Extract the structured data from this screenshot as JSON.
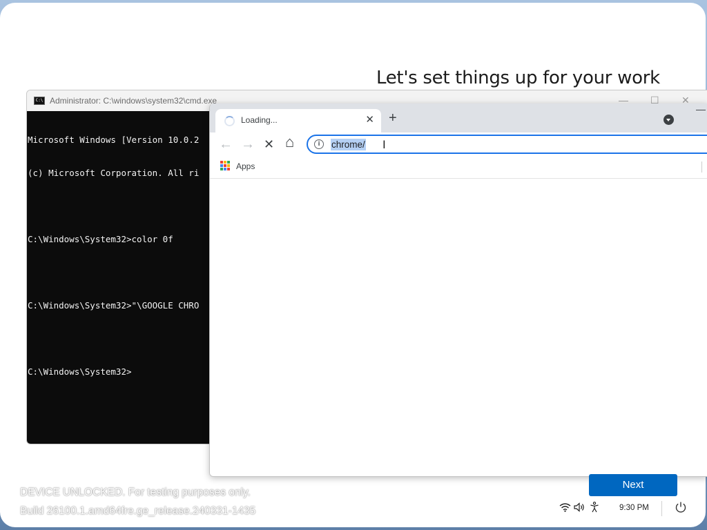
{
  "oobe": {
    "title": "Let's set things up for your work",
    "next_label": "Next",
    "watermark_line1": "DEVICE UNLOCKED. For testing purposes only.",
    "watermark_line2": "Build 26100.1.amd64fre.ge_release.240331-1435"
  },
  "cmd": {
    "title": "Administrator: C:\\windows\\system32\\cmd.exe",
    "lines": [
      "Microsoft Windows [Version 10.0.2",
      "(c) Microsoft Corporation. All ri",
      "",
      "C:\\Windows\\System32>color 0f",
      "",
      "C:\\Windows\\System32>\"\\GOOGLE CHRO",
      "",
      "C:\\Windows\\System32>"
    ],
    "controls": {
      "minimize": "—",
      "maximize": "☐",
      "close": "✕"
    }
  },
  "chrome": {
    "tab_title": "Loading...",
    "tab_close": "✕",
    "new_tab": "+",
    "omnibox_value": "chrome/",
    "bookmarks": {
      "apps_label": "Apps"
    },
    "nav": {
      "back": "←",
      "forward": "→",
      "stop": "✕",
      "home": "⌂"
    },
    "icons": [
      "loading-spinner-icon",
      "back-arrow-icon",
      "forward-arrow-icon",
      "stop-icon",
      "home-icon",
      "info-icon",
      "apps-grid-icon",
      "tab-search-icon"
    ]
  },
  "tray": {
    "time": "9:30 PM",
    "wifi": "wifi-icon",
    "volume": "volume-icon",
    "accessibility": "accessibility-icon",
    "power": "power-icon"
  },
  "colors": {
    "accent": "#0067c0",
    "omnibox_focus": "#1a73e8",
    "selection": "#b5d0f4",
    "cmd_bg": "#0c0c0c"
  }
}
